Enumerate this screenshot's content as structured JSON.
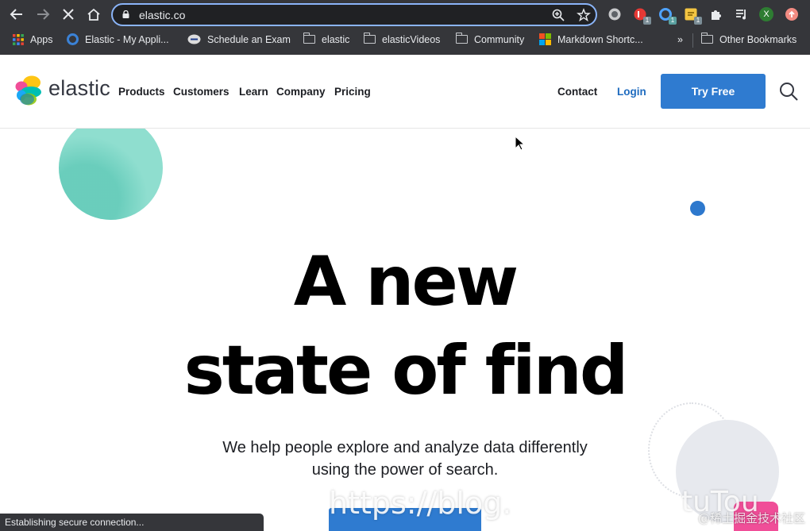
{
  "browser": {
    "url": "elastic.co",
    "status": "Establishing secure connection...",
    "bookmarks": {
      "apps": "Apps",
      "elastic_my_apps": "Elastic - My Appli...",
      "schedule_exam": "Schedule an Exam",
      "elastic": "elastic",
      "elastic_videos": "elasticVideos",
      "community": "Community",
      "markdown": "Markdown Shortc...",
      "overflow": "»",
      "other": "Other Bookmarks"
    },
    "extensions": {
      "badge1": "1",
      "badge2": "1",
      "badge3": "1",
      "profile": "X"
    }
  },
  "site": {
    "brand": "elastic",
    "nav": {
      "products": "Products",
      "customers": "Customers",
      "learn": "Learn",
      "company": "Company",
      "pricing": "Pricing",
      "contact": "Contact",
      "login": "Login",
      "try_free": "Try Free"
    },
    "hero": {
      "headline_line1": "A new",
      "headline_line2": "state of find",
      "subtitle_line1": "We help people explore and analyze data differently",
      "subtitle_line2": "using the power of search."
    }
  },
  "overlay": {
    "text_left": "https://blog.",
    "text_right": "tuTou",
    "watermark": "@稀土掘金技术社区"
  }
}
